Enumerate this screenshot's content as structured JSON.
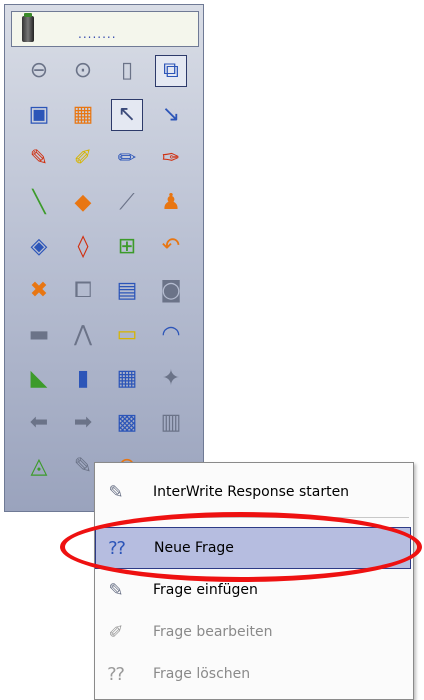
{
  "toolbar": {
    "header_dots": "........",
    "rows": [
      [
        "minus-circle-icon",
        "chevron-down-circle-icon",
        "mouse-icon",
        "page-stack-icon"
      ],
      [
        "whiteboard-icon",
        "color-palette-icon",
        "arrow-cursor-icon",
        "pointer-pen-icon"
      ],
      [
        "spell-pen-icon",
        "highlighter-icon",
        "marker-icon",
        "crayon-icon"
      ],
      [
        "line-pen-icon",
        "shapes-icon",
        "stylus-icon",
        "stamp-icon"
      ],
      [
        "fill-bucket-icon",
        "eraser-icon",
        "text-abc-icon",
        "undo-icon"
      ],
      [
        "delete-x-icon",
        "copy-icon",
        "screen-icon",
        "camera-icon"
      ],
      [
        "slides-icon",
        "compass-icon",
        "ruler-icon",
        "protractor-icon"
      ],
      [
        "set-square-icon",
        "blank-page-icon",
        "grid-page-icon",
        "clipart-icon"
      ],
      [
        "back-arrow-icon",
        "forward-arrow-icon",
        "keyboard-icon",
        "save-icon"
      ],
      [
        "scale-icon",
        "response-clicker-icon",
        "close-circle-icon"
      ]
    ]
  },
  "context_menu": {
    "items": [
      {
        "label": "InterWrite Response starten",
        "icon": "response-remote-icon",
        "enabled": true
      },
      {
        "label": "Neue Frage",
        "icon": "new-question-icon",
        "enabled": true,
        "highlighted": true
      },
      {
        "label": "Frage einfügen",
        "icon": "insert-question-icon",
        "enabled": true
      },
      {
        "label": "Frage bearbeiten",
        "icon": "edit-question-icon",
        "enabled": false
      },
      {
        "label": "Frage löschen",
        "icon": "delete-question-icon",
        "enabled": false
      }
    ]
  },
  "colors": {
    "highlight_ring": "#ee1111",
    "menu_hover": "#b6bde0"
  }
}
